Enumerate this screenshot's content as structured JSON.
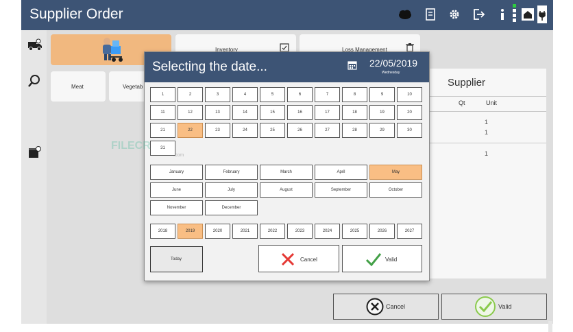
{
  "app": {
    "title": "Supplier Order"
  },
  "top_icons": [
    "cloud-icon",
    "document-icon",
    "gear-icon",
    "exit-icon",
    "info-icon",
    "store-icon",
    "plug-icon"
  ],
  "left_icons": [
    "truck-icon",
    "search-icon",
    "box-icon"
  ],
  "cards": {
    "inventory": "Inventory",
    "loss": "Loss Management",
    "meat": "Meat",
    "vegetables": "Vegetab"
  },
  "panel": {
    "title": "Supplier",
    "col_qty": "Qt",
    "col_unit": "Unit",
    "quantities": [
      "1",
      "1",
      "1"
    ]
  },
  "main_buttons": {
    "cancel": "Cancel",
    "valid": "Valid"
  },
  "dialog": {
    "title": "Selecting the date...",
    "date": "22/05/2019",
    "weekday": "Wednesday",
    "days": [
      "1",
      "2",
      "3",
      "4",
      "5",
      "6",
      "7",
      "8",
      "9",
      "10",
      "11",
      "12",
      "13",
      "14",
      "15",
      "16",
      "17",
      "18",
      "19",
      "20",
      "21",
      "22",
      "23",
      "24",
      "25",
      "26",
      "27",
      "28",
      "29",
      "30",
      "31"
    ],
    "selected_day": "22",
    "months": [
      "January",
      "February",
      "March",
      "April",
      "May",
      "June",
      "July",
      "August",
      "September",
      "October",
      "November",
      "December"
    ],
    "selected_month": "May",
    "years": [
      "2018",
      "2019",
      "2020",
      "2021",
      "2022",
      "2023",
      "2024",
      "2025",
      "2026",
      "2027"
    ],
    "selected_year": "2019",
    "today_label": "Today",
    "cancel_label": "Cancel",
    "valid_label": "Valid"
  },
  "watermark": {
    "text": "FILECR",
    "sub": ".com"
  },
  "colors": {
    "header": "#3d5475",
    "selected": "#f9be84",
    "cancel_x": "#e53935",
    "valid_check": "#43a047"
  }
}
